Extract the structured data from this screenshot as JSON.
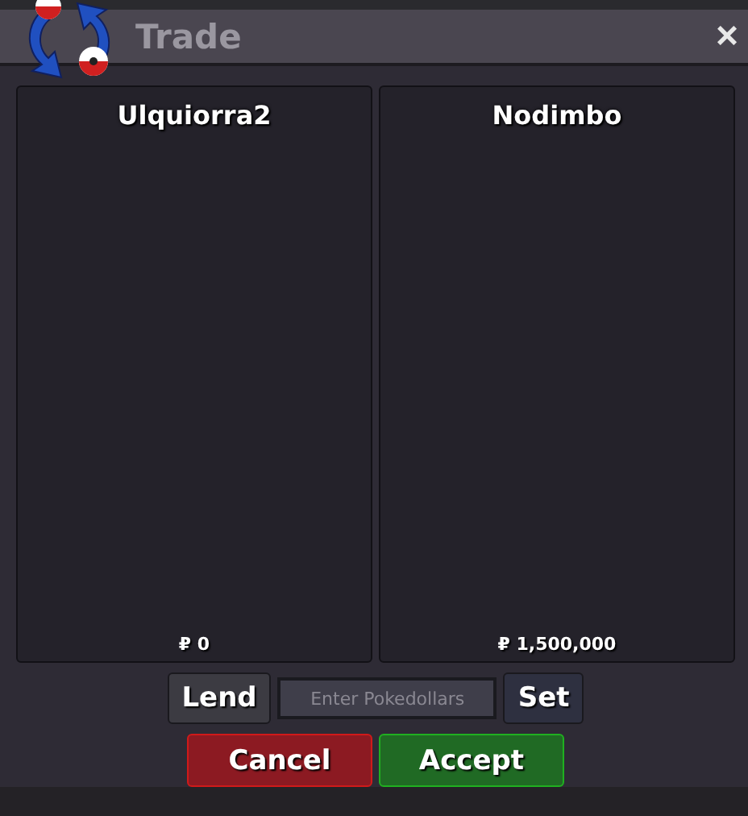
{
  "window": {
    "title": "Trade"
  },
  "close": "×",
  "offers": [
    {
      "name": "Ulquiorra2",
      "money": "₽ 0"
    },
    {
      "name": "Nodimbo",
      "money": "₽ 1,500,000"
    }
  ],
  "lend_button": "Lend",
  "money_field": {
    "placeholder": "Enter Pokedollars"
  },
  "set_button": "Set",
  "buttons": [
    {
      "label": "Cancel",
      "kind": "cancel"
    },
    {
      "label": "Accept",
      "kind": "accept"
    }
  ]
}
